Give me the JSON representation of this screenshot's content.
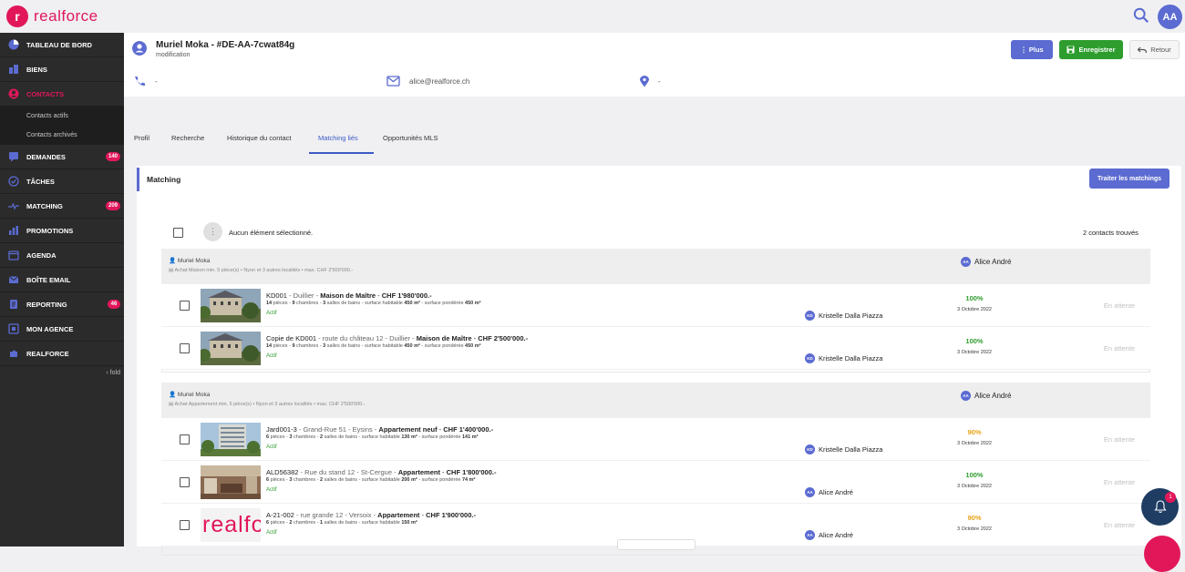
{
  "app": {
    "logo_text": "realforce",
    "logo_mark": "r",
    "user_initials": "AA"
  },
  "sidebar": {
    "items": [
      {
        "label": "TABLEAU DE BORD",
        "icon": "dashboard-icon"
      },
      {
        "label": "BIENS",
        "icon": "building-icon"
      },
      {
        "label": "CONTACTS",
        "icon": "user-circle-icon",
        "active": true
      },
      {
        "label": "DEMANDES",
        "icon": "chat-icon",
        "badge": "140"
      },
      {
        "label": "TÂCHES",
        "icon": "check-circle-icon"
      },
      {
        "label": "MATCHING",
        "icon": "matching-icon",
        "badge": "209"
      },
      {
        "label": "PROMOTIONS",
        "icon": "chart-icon"
      },
      {
        "label": "AGENDA",
        "icon": "calendar-icon"
      },
      {
        "label": "BOÎTE EMAIL",
        "icon": "mail-icon"
      },
      {
        "label": "REPORTING",
        "icon": "report-icon",
        "badge": "46"
      },
      {
        "label": "MON AGENCE",
        "icon": "agency-icon"
      },
      {
        "label": "REALFORCE",
        "icon": "puzzle-icon"
      }
    ],
    "sub_items": [
      "Contacts actifs",
      "Contacts archivés"
    ],
    "fold": "‹ fold"
  },
  "header": {
    "title": "Muriel Moka - #DE-AA-7cwat84g",
    "subtitle": "modification",
    "btn_plus": "⋮  Plus",
    "btn_save": "Enregistrer",
    "btn_back": "Retour",
    "phone": "-",
    "email": "alice@realforce.ch",
    "location": "-"
  },
  "tabs": [
    "Profil",
    "Recherche",
    "Historique du contact",
    "Matching liés",
    "Opportunités MLS"
  ],
  "matching": {
    "title": "Matching",
    "treat_btn": "Traiter les matchings",
    "selection": "Aucun élément sélectionné.",
    "found": "2 contacts trouvés"
  },
  "groups": [
    {
      "name": "Muriel Moka",
      "criteria": "Achat Maison min. 5 pièce(s) • Nyon et 3 autres localités • max. CHF 2'500'000.-",
      "agent": "Alice André",
      "agent_initials": "AA",
      "rows": [
        {
          "ref": "KD001",
          "addr": "Duillier",
          "type": "Maison de Maître",
          "price": "CHF 1'980'000.-",
          "rooms": "14",
          "beds": "9",
          "baths": "3",
          "surf": "450 m²",
          "surf_p": "450 m²",
          "status": "Actif",
          "agent": "Kristelle Dalla Piazza",
          "agent_initials": "KD",
          "pct": "100%",
          "pct_color": "#2e9d2e",
          "date": "3 Octobre 2022",
          "state": "En attente",
          "thumb": "chateau"
        },
        {
          "ref": "Copie de KD001",
          "addr": "route du château 12 - Duillier",
          "type": "Maison de Maître",
          "price": "CHF 2'500'000.-",
          "rooms": "14",
          "beds": "9",
          "baths": "3",
          "surf": "450 m²",
          "surf_p": "450 m²",
          "status": "Actif",
          "agent": "Kristelle Dalla Piazza",
          "agent_initials": "KD",
          "pct": "100%",
          "pct_color": "#2e9d2e",
          "date": "3 Octobre 2022",
          "state": "En attente",
          "thumb": "chateau"
        }
      ]
    },
    {
      "name": "Muriel Moka",
      "criteria": "Achat Appartement min. 5 pièce(s) • Nyon et 3 autres localités • max. CHF 2'500'000.-",
      "agent": "Alice André",
      "agent_initials": "AA",
      "rows": [
        {
          "ref": "Jard001-3",
          "addr": "Grand-Rue 51 - Eysins",
          "type": "Appartement neuf",
          "price": "CHF 1'400'000.-",
          "rooms": "6",
          "beds": "3",
          "baths": "2",
          "surf": "130 m²",
          "surf_p": "141 m²",
          "status": "Actif",
          "agent": "Kristelle Dalla Piazza",
          "agent_initials": "KD",
          "pct": "90%",
          "pct_color": "#e8a317",
          "date": "3 Octobre 2022",
          "state": "En attente",
          "thumb": "building"
        },
        {
          "ref": "ALD56382",
          "addr": "Rue du stand 12 - St-Cergue",
          "type": "Appartement",
          "price": "CHF 1'800'000.-",
          "rooms": "6",
          "beds": "3",
          "baths": "2",
          "surf": "200 m²",
          "surf_p": "74 m²",
          "status": "Actif",
          "agent": "Alice André",
          "agent_initials": "AA",
          "pct": "100%",
          "pct_color": "#2e9d2e",
          "date": "3 Octobre 2022",
          "state": "En attente",
          "thumb": "interior"
        },
        {
          "ref": "A-21-002",
          "addr": "rue grande 12 - Versoix",
          "type": "Appartement",
          "price": "CHF 1'900'000.-",
          "rooms": "6",
          "beds": "2",
          "baths": "1",
          "surf": "150 m²",
          "surf_p": "",
          "status": "Actif",
          "agent": "Alice André",
          "agent_initials": "AA",
          "pct": "90%",
          "pct_color": "#e8a317",
          "date": "3 Octobre 2022",
          "state": "En attente",
          "thumb": "logo"
        }
      ]
    }
  ],
  "notifications": {
    "count": "1"
  },
  "colors": {
    "accent": "#5b6bd1",
    "brand": "#e1175a",
    "success": "#2e9d2e",
    "warning": "#e8a317",
    "save_btn": "#2e9d2e"
  }
}
